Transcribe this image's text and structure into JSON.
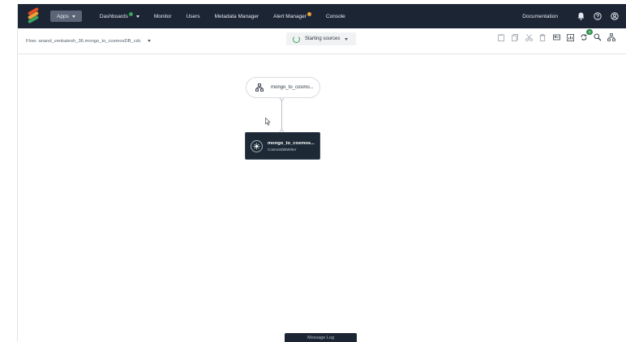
{
  "nav": {
    "items": [
      {
        "label": "Apps",
        "active": true,
        "has_caret": true
      },
      {
        "label": "Dashboards",
        "has_dot": true,
        "dot_color": "#3aa35c",
        "has_caret": true
      },
      {
        "label": "Monitor"
      },
      {
        "label": "Users"
      },
      {
        "label": "Metadata Manager"
      },
      {
        "label": "Alert Manager",
        "has_dot": true,
        "dot_color": "#f0a23a"
      },
      {
        "label": "Console"
      }
    ],
    "documentation_label": "Documentation",
    "icons": [
      "bell-icon",
      "help-icon",
      "user-icon"
    ]
  },
  "toolbar": {
    "flow_label": "Flow: anand_venkatesh_36.mongo_to_cosmosDB_cdc",
    "status_label": "Starting sources",
    "status_color": "#3aa35c",
    "tools": [
      "paste-icon",
      "copy-icon",
      "cut-icon",
      "delete-icon",
      "card-icon",
      "chart-icon",
      "sync-icon",
      "search-icon",
      "hierarchy-icon"
    ],
    "sync_badge": "0"
  },
  "canvas": {
    "source_node": {
      "label": "mongo_to_cosmo..."
    },
    "target_node": {
      "name": "mongo_to_cosmos...",
      "type": "CosmosDBWriter"
    }
  },
  "footer": {
    "message_log_label": "Message Log"
  },
  "colors": {
    "nav_bg": "#1c2534",
    "accent_green": "#2e8f4a",
    "node_dark": "#1d2a36"
  }
}
